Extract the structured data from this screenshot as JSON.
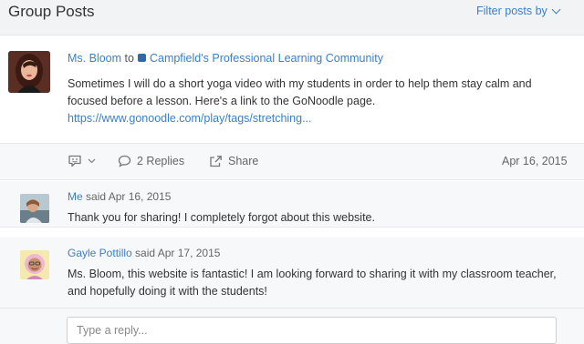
{
  "header": {
    "title": "Group Posts",
    "filter_label": "Filter posts by"
  },
  "post": {
    "author": "Ms. Bloom",
    "to_word": "to",
    "group": "Campfield's Professional Learning Community",
    "body_text": "Sometimes I will do a short yoga video with my students in order to help them stay calm and focused before a lesson. Here's a link to the GoNoodle page. ",
    "link_text": "https://www.gonoodle.com/play/tags/stretching...",
    "replies_label": "2 Replies",
    "share_label": "Share",
    "date": "Apr 16, 2015"
  },
  "comments": [
    {
      "author": "Me",
      "said": "said Apr 16, 2015",
      "text": "Thank you for sharing! I completely forgot about this website."
    },
    {
      "author": "Gayle Pottillo",
      "said": "said Apr 17, 2015",
      "text": "Ms. Bloom, this website is fantastic! I am looking forward to sharing it with my classroom teacher, and hopefully doing it with the students!"
    }
  ],
  "reply": {
    "placeholder": "Type a reply..."
  },
  "colors": {
    "link": "#3a7fc8",
    "background": "#f2f3f5"
  }
}
